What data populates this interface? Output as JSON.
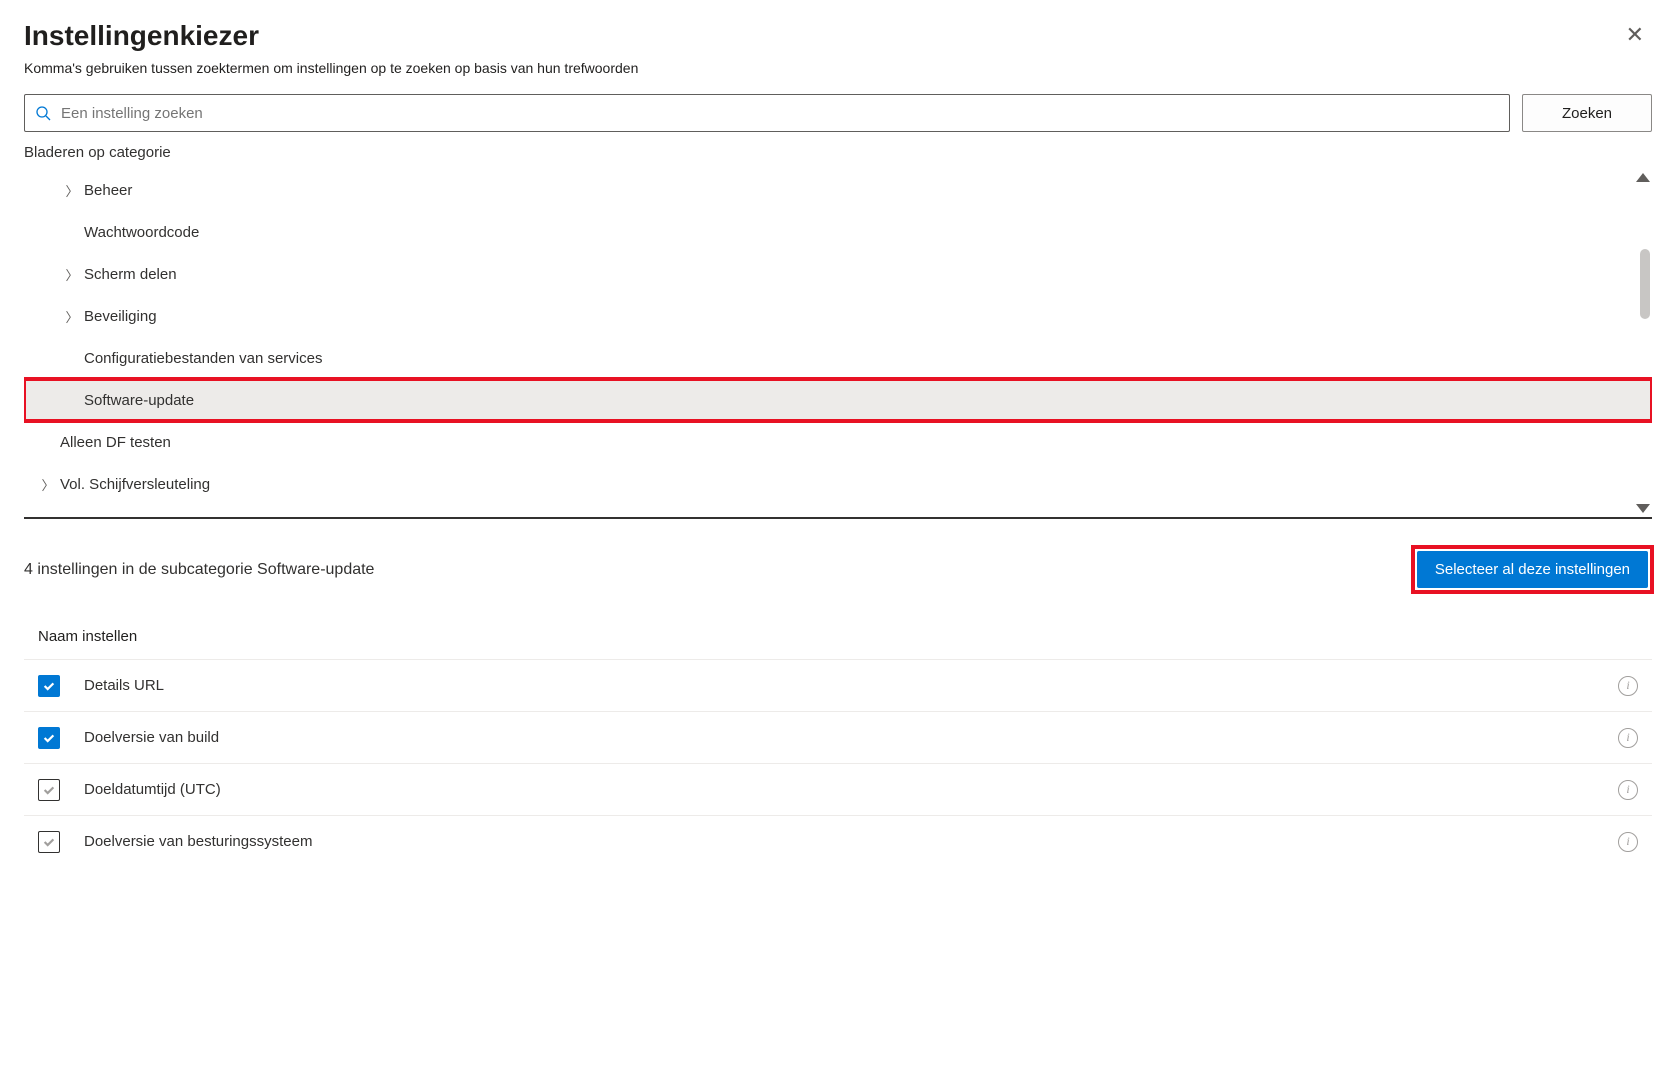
{
  "header": {
    "title": "Instellingenkiezer",
    "subtitle": "Komma's gebruiken tussen zoektermen om instellingen op te zoeken op basis van hun trefwoorden"
  },
  "search": {
    "placeholder": "Een instelling zoeken",
    "button": "Zoeken"
  },
  "browse_label": "Bladeren op categorie",
  "categories": [
    {
      "label": "Beheer",
      "expandable": true,
      "level": 1
    },
    {
      "label": "Wachtwoordcode",
      "expandable": false,
      "level": 1
    },
    {
      "label": "Scherm delen",
      "expandable": true,
      "level": 1
    },
    {
      "label": "Beveiliging",
      "expandable": true,
      "level": 1
    },
    {
      "label": "Configuratiebestanden van services",
      "expandable": false,
      "level": 1
    },
    {
      "label": "Software-update",
      "expandable": false,
      "level": 1,
      "selected": true,
      "highlight": true
    },
    {
      "label": "Alleen DF testen",
      "expandable": false,
      "level": 0
    },
    {
      "label": "Vol. Schijfversleuteling",
      "expandable": true,
      "level": 0
    }
  ],
  "results": {
    "summary": "4 instellingen in de subcategorie Software-update",
    "select_all": "Selecteer al deze instellingen",
    "column_header": "Naam instellen",
    "items": [
      {
        "label": "Details URL",
        "checked": true
      },
      {
        "label": "Doelversie van build",
        "checked": true
      },
      {
        "label": "Doeldatumtijd (UTC)",
        "checked": false
      },
      {
        "label": "Doelversie van besturingssysteem",
        "checked": false
      }
    ]
  }
}
